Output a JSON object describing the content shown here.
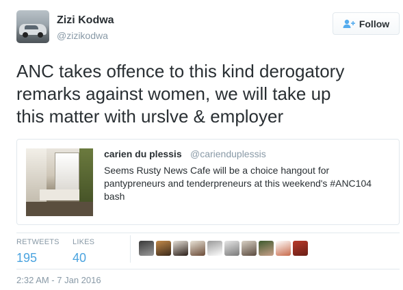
{
  "author": {
    "name": "Zizi Kodwa",
    "handle": "@zizikodwa"
  },
  "follow_button": {
    "label": "Follow",
    "icon": "follow-user-plus-icon"
  },
  "tweet": {
    "text": "ANC takes offence to this kind derogatory\nremarks against women, we will take up\nthis  matter with urslve & employer"
  },
  "quoted_tweet": {
    "name": "carien du plessis",
    "handle": "@carienduplessis",
    "text": "Seems Rusty News Cafe will be a choice hangout for pantypreneurs and tenderpreneurs at this weekend's #ANC104 bash"
  },
  "stats": {
    "retweets_label": "RETWEETS",
    "retweets_value": "195",
    "likes_label": "LIKES",
    "likes_value": "40"
  },
  "likers": [
    {
      "name": "liker-avatar-1",
      "colors": [
        "#3a3a3a",
        "#9a9a9a"
      ]
    },
    {
      "name": "liker-avatar-2",
      "colors": [
        "#c28a4a",
        "#3b2a1a"
      ]
    },
    {
      "name": "liker-avatar-3",
      "colors": [
        "#e7e1d8",
        "#2a1e18"
      ]
    },
    {
      "name": "liker-avatar-4",
      "colors": [
        "#e8e2d6",
        "#6a4a36"
      ]
    },
    {
      "name": "liker-avatar-5",
      "colors": [
        "#9a9a9a",
        "#ffffff"
      ]
    },
    {
      "name": "liker-avatar-6",
      "colors": [
        "#e6e6e6",
        "#7a7a7a"
      ]
    },
    {
      "name": "liker-avatar-7",
      "colors": [
        "#d8d0c4",
        "#5a4a3e"
      ]
    },
    {
      "name": "liker-avatar-8",
      "colors": [
        "#3e5a2e",
        "#c8a08a"
      ]
    },
    {
      "name": "liker-avatar-9",
      "colors": [
        "#ffffff",
        "#c86a4a"
      ]
    },
    {
      "name": "liker-avatar-10",
      "colors": [
        "#b83a2a",
        "#6a1e16"
      ]
    }
  ],
  "timestamp": "2:32 AM - 7 Jan 2016",
  "colors": {
    "link_blue": "#4aa3df",
    "muted_gray": "#8899a6",
    "text_dark": "#292f33",
    "border": "#e1e8ed"
  }
}
